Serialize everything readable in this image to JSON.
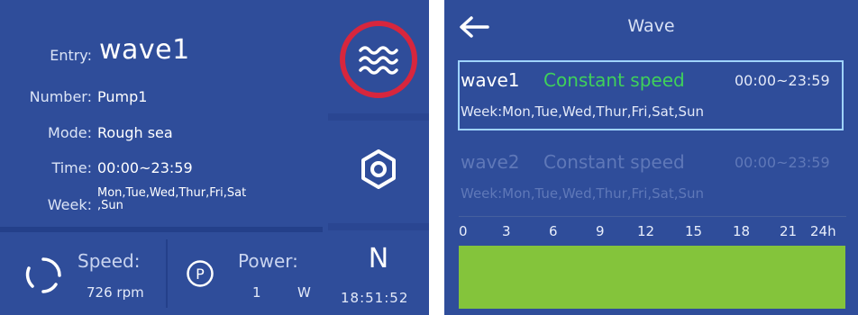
{
  "left_panel": {
    "entry_label": "Entry:",
    "entry_value": "wave1",
    "number_label": "Number:",
    "number_value": "Pump1",
    "mode_label": "Mode:",
    "mode_value": "Rough sea",
    "time_label": "Time:",
    "time_value": "00:00~23:59",
    "week_label": "Week:",
    "week_value_line1": "Mon,Tue,Wed,Thur,Fri,Sat",
    "week_value_line2": ",Sun",
    "speed_label": "Speed:",
    "speed_value": "726 rpm",
    "power_label": "Power:",
    "power_value": "1",
    "power_unit": "W",
    "buttons": {
      "wave_icon": "wave-icon",
      "settings_icon": "hex-nut-icon",
      "direction_letter": "N",
      "clock": "18:51:52"
    },
    "colors": {
      "panel": "#2f4d9a",
      "highlight_ring": "#d7263d"
    }
  },
  "wave_screen": {
    "title": "Wave",
    "entries": [
      {
        "name": "wave1",
        "mode": "Constant speed",
        "time": "00:00~23:59",
        "week": "Week:Mon,Tue,Wed,Thur,Fri,Sat,Sun",
        "selected": true
      },
      {
        "name": "wave2",
        "mode": "Constant speed",
        "time": "00:00~23:59",
        "week": "Week:Mon,Tue,Wed,Thur,Fri,Sat,Sun",
        "selected": false
      }
    ],
    "timeline_ticks": [
      "0",
      "3",
      "6",
      "9",
      "12",
      "15",
      "18",
      "21",
      "24h"
    ],
    "colors": {
      "selected_border": "#9fd3ff",
      "mode_green": "#3fd15a",
      "timeline_bar": "#84c43b"
    }
  }
}
